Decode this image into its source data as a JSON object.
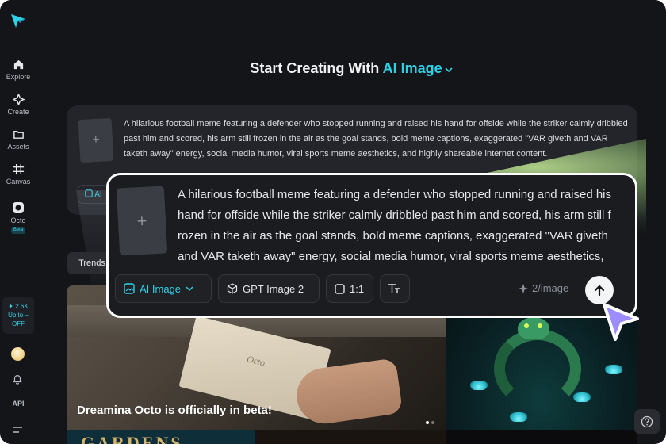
{
  "sidebar": {
    "items": [
      {
        "label": "Explore",
        "icon": "home-icon"
      },
      {
        "label": "Create",
        "icon": "sparkle-icon"
      },
      {
        "label": "Assets",
        "icon": "folder-icon"
      },
      {
        "label": "Canvas",
        "icon": "canvas-icon"
      },
      {
        "label": "Octo",
        "icon": "octo-icon",
        "badge": "Beta"
      }
    ],
    "credits": {
      "amount": "2.6K",
      "promo_line1": "Up to –",
      "promo_line2": "OFF"
    },
    "api_label": "API"
  },
  "header": {
    "title_prefix": "Start Creating With",
    "title_accent": "AI Image",
    "accent_color": "#2ed0e6"
  },
  "prompt": {
    "text": "A hilarious football meme featuring a defender who stopped running and raised his hand for offside while the striker calmly dribbled past him and scored, his arm still frozen in the air as the goal stands, bold meme captions, exaggerated \"VAR giveth and VAR taketh away\" energy, social media humor, viral sports meme aesthetics, and highly shareable internet content.",
    "background_chip_label": "AI",
    "toolbar": {
      "mode_label": "AI Image",
      "model_label": "GPT Image 2",
      "ratio_label": "1:1",
      "cost_label": "2/image"
    }
  },
  "tabs": {
    "trends_label": "Trends"
  },
  "gallery": {
    "feature_caption": "Dreamina Octo is officially in beta!",
    "envelope_text": "Octo",
    "row2_text": "GARDENS"
  }
}
